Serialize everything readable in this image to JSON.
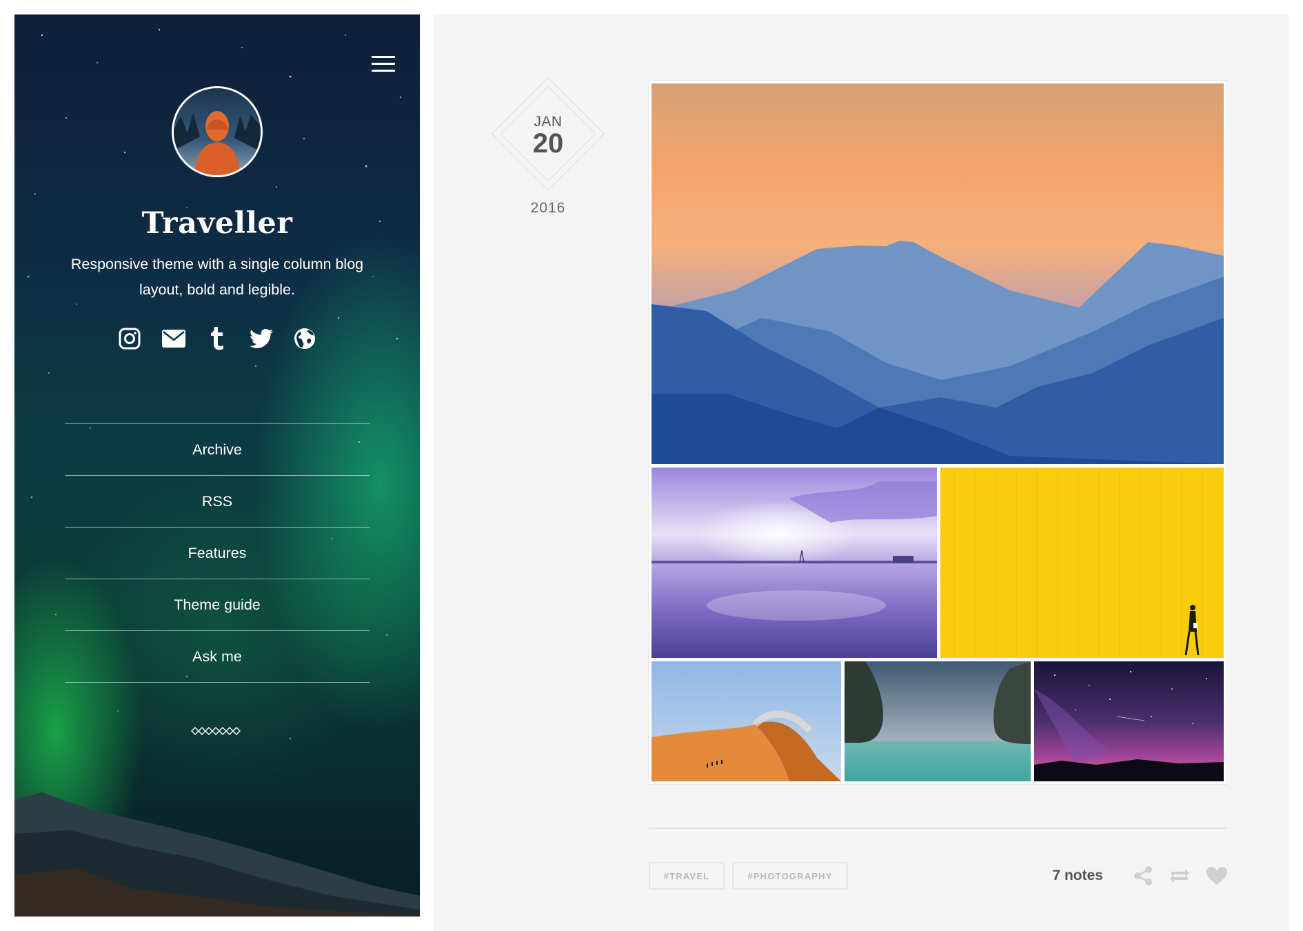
{
  "sidebar": {
    "title": "Traveller",
    "description": "Responsive theme with a single column blog layout, bold and legible.",
    "social_icons": [
      "instagram-icon",
      "mail-icon",
      "tumblr-icon",
      "twitter-icon",
      "globe-icon"
    ],
    "nav": [
      {
        "label": "Archive"
      },
      {
        "label": "RSS"
      },
      {
        "label": "Features"
      },
      {
        "label": "Theme guide"
      },
      {
        "label": "Ask me"
      }
    ],
    "divider_icon": "diamond-chain-icon"
  },
  "post": {
    "date": {
      "month": "JAN",
      "day": "20",
      "year": "2016"
    },
    "photos": [
      {
        "name": "mountain-sunset-photo"
      },
      {
        "name": "purple-lake-photo"
      },
      {
        "name": "yellow-wall-photo"
      },
      {
        "name": "desert-dune-photo"
      },
      {
        "name": "sea-cliffs-photo"
      },
      {
        "name": "starry-sky-photo"
      }
    ],
    "tags": [
      "#TRAVEL",
      "#PHOTOGRAPHY"
    ],
    "notes": "7 notes",
    "actions": [
      "share-icon",
      "reblog-icon",
      "like-icon"
    ]
  },
  "colors": {
    "sidebar_top": "#0f1f3a",
    "aurora_green": "#19d782",
    "main_bg": "#f4f4f4",
    "text_dark": "#555555",
    "tag_text": "#b8b8b8"
  }
}
